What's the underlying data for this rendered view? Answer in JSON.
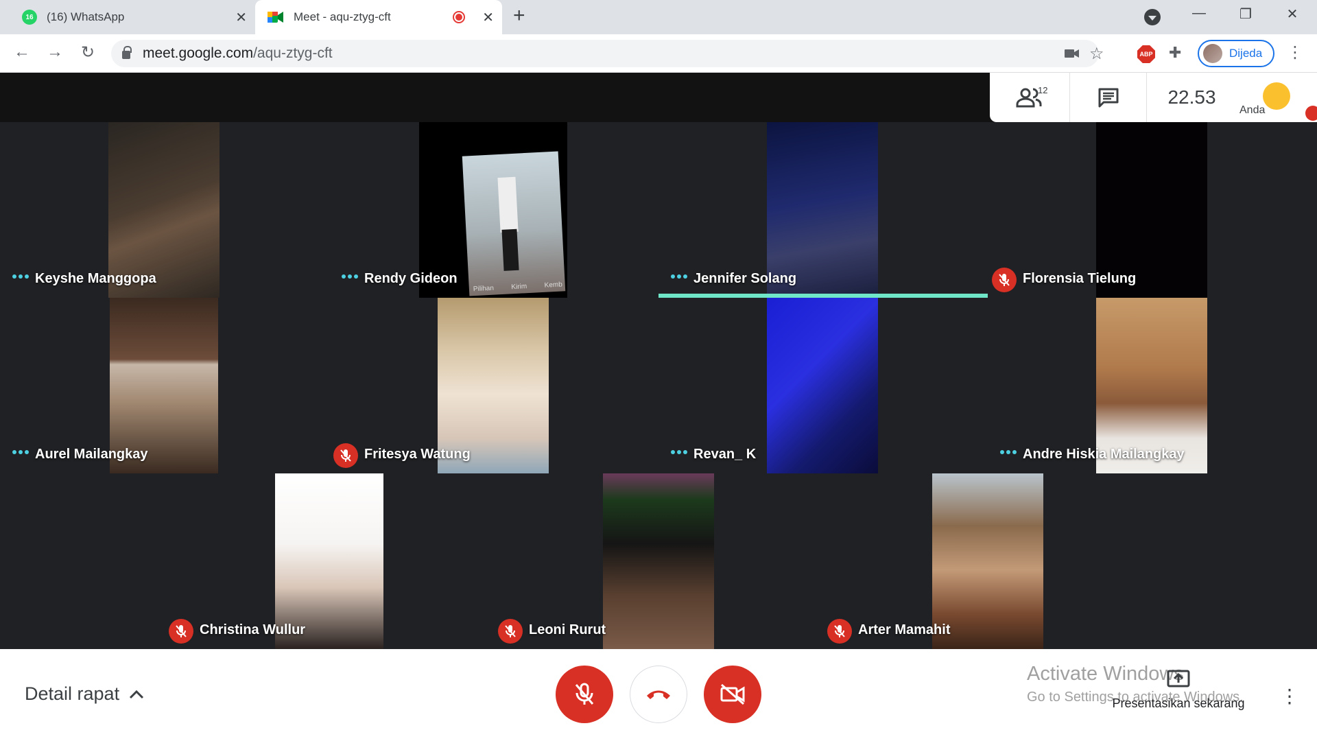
{
  "browser": {
    "tabs": [
      {
        "badge": "16",
        "title": "(16) WhatsApp"
      },
      {
        "title": "Meet - aqu-ztyg-cft"
      }
    ],
    "url_host": "meet.google.com",
    "url_path": "/aqu-ztyg-cft",
    "profile_name": "Dijeda",
    "abp_label": "ABP"
  },
  "meet": {
    "people_count": "12",
    "clock": "22.53",
    "self_label": "Anda",
    "participants": [
      {
        "name": "Keyshe Manggopa",
        "muted": false,
        "speaking": false
      },
      {
        "name": "Rendy Gideon",
        "muted": false,
        "speaking": false
      },
      {
        "name": "Jennifer Solang",
        "muted": false,
        "speaking": true
      },
      {
        "name": "Florensia Tielung",
        "muted": true,
        "speaking": false
      },
      {
        "name": "Aurel Mailangkay",
        "muted": false,
        "speaking": false
      },
      {
        "name": "Fritesya Watung",
        "muted": true,
        "speaking": false
      },
      {
        "name": "Revan_ K",
        "muted": false,
        "speaking": false
      },
      {
        "name": "Andre Hiskia Mailangkay",
        "muted": false,
        "speaking": false
      },
      {
        "name": "Christina Wullur",
        "muted": true,
        "speaking": false
      },
      {
        "name": "Leoni Rurut",
        "muted": true,
        "speaking": false
      },
      {
        "name": "Arter Mamahit",
        "muted": true,
        "speaking": false
      }
    ],
    "video_photo_text": [
      "Pilihan",
      "Kirim",
      "Kemb"
    ]
  },
  "bottom": {
    "detail_label": "Detail rapat",
    "present_label": "Presentasikan sekarang",
    "activate_title": "Activate Windows",
    "activate_sub": "Go to Settings to activate Windows."
  },
  "colors": {
    "accent_red": "#d93025",
    "speaking_bar": "#6ee6c7",
    "link_blue": "#1a73e8"
  }
}
